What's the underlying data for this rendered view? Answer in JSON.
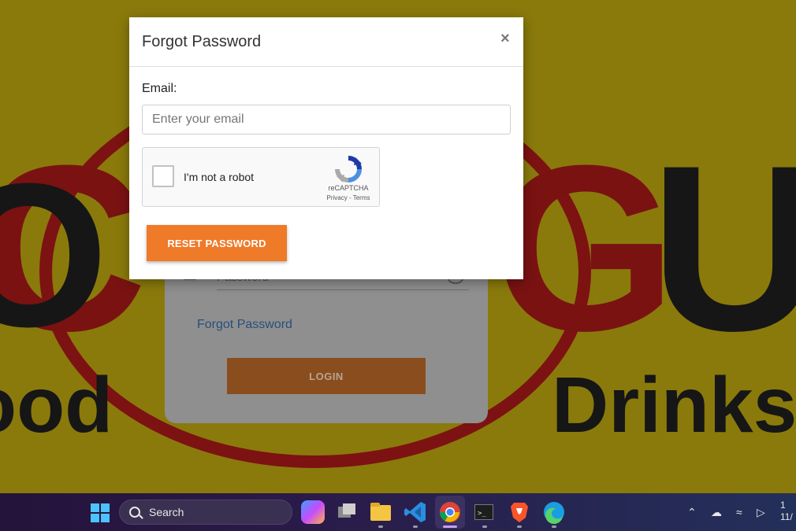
{
  "background": {
    "letters_left": "O",
    "letters_g": "G",
    "letters_u": "U",
    "text_left": "ood",
    "text_right": "Drinks"
  },
  "login_card": {
    "password_placeholder": "Password",
    "forgot_link": "Forgot Password",
    "login_button": "LOGIN"
  },
  "modal": {
    "title": "Forgot Password",
    "close_label": "×",
    "email_label": "Email:",
    "email_placeholder": "Enter your email",
    "email_value": "",
    "recaptcha": {
      "checkbox_label": "I'm not a robot",
      "brand": "reCAPTCHA",
      "links": "Privacy - Terms"
    },
    "reset_button": "RESET PASSWORD"
  },
  "taskbar": {
    "search_label": "Search",
    "apps": [
      "copilot-icon",
      "task-view-icon",
      "file-explorer-icon",
      "vscode-icon",
      "chrome-icon",
      "terminal-icon",
      "brave-icon",
      "edge-icon"
    ],
    "active_app": "chrome-icon",
    "clock_line1": "1",
    "clock_line2": "11/"
  },
  "colors": {
    "accent_orange": "#ef7a28",
    "link_blue": "#274e7d"
  }
}
